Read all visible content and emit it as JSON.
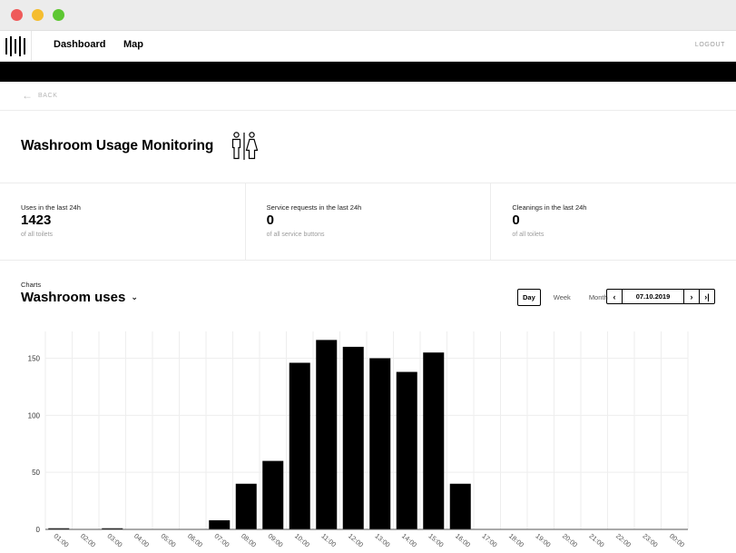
{
  "navbar": {
    "links": [
      "Dashboard",
      "Map"
    ],
    "logout": "LOGOUT"
  },
  "back": {
    "label": "BACK"
  },
  "page": {
    "title": "Washroom Usage Monitoring"
  },
  "stats": [
    {
      "label": "Uses in the last 24h",
      "value": "1423",
      "sub": "of all toilets"
    },
    {
      "label": "Service requests in the last 24h",
      "value": "0",
      "sub": "of all service buttons"
    },
    {
      "label": "Cleanings in the last 24h",
      "value": "0",
      "sub": "of all toilets"
    }
  ],
  "charts": {
    "section_label": "Charts",
    "selected": "Washroom uses",
    "periods": [
      "Day",
      "Week",
      "Month"
    ],
    "active_period": "Day",
    "date": "07.10.2019"
  },
  "chart_data": {
    "type": "bar",
    "categories": [
      "01:00",
      "02:00",
      "03:00",
      "04:00",
      "05:00",
      "06:00",
      "07:00",
      "08:00",
      "09:00",
      "10:00",
      "11:00",
      "12:00",
      "13:00",
      "14:00",
      "15:00",
      "16:00",
      "17:00",
      "18:00",
      "19:00",
      "20:00",
      "21:00",
      "22:00",
      "23:00",
      "00:00"
    ],
    "values": [
      1,
      0,
      1,
      0,
      0,
      0,
      8,
      40,
      60,
      146,
      166,
      160,
      150,
      138,
      155,
      40,
      0,
      0,
      0,
      0,
      0,
      0,
      0,
      0
    ],
    "yticks": [
      0,
      50,
      100,
      150
    ],
    "ylim": [
      0,
      170
    ],
    "grid": true,
    "bar_color": "#000000"
  }
}
